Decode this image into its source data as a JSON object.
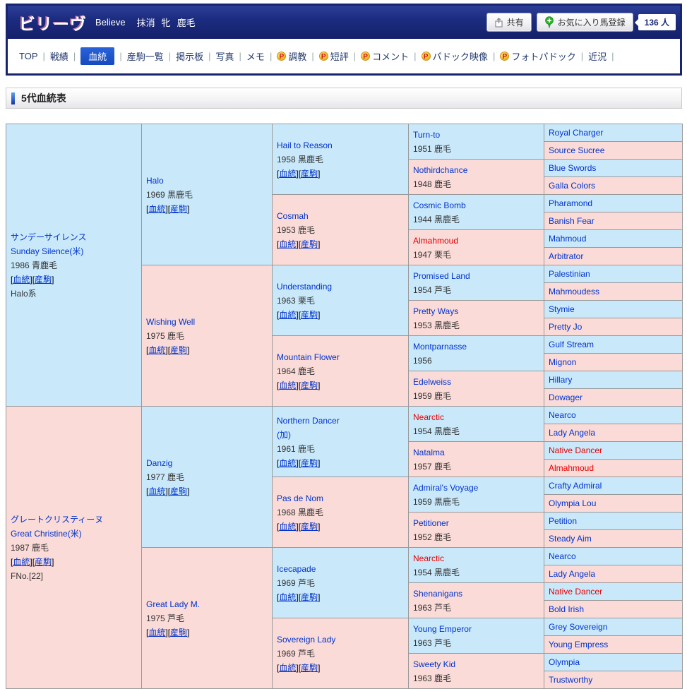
{
  "header": {
    "title": "ビリーヴ",
    "title_en": "Believe",
    "status": "抹消",
    "sex": "牝",
    "coat": "鹿毛",
    "share_label": "共有",
    "favorite_label": "お気に入り馬登録",
    "fans_label": "136 人"
  },
  "nav": {
    "separator": "|",
    "p_icon": "P",
    "items": [
      {
        "label": "TOP"
      },
      {
        "label": "戦績"
      },
      {
        "label": "血統",
        "active": true
      },
      {
        "label": "産駒一覧"
      },
      {
        "label": "掲示板"
      },
      {
        "label": "写真"
      },
      {
        "label": "メモ"
      },
      {
        "label": "調教",
        "p": true
      },
      {
        "label": "短評",
        "p": true
      },
      {
        "label": "コメント",
        "p": true
      },
      {
        "label": "パドック映像",
        "p": true
      },
      {
        "label": "フォトパドック",
        "p": true
      },
      {
        "label": "近況"
      }
    ]
  },
  "section": {
    "title": "5代血統表"
  },
  "colors": {
    "male_bg": "#c9e9fb",
    "female_bg": "#fbdbd8",
    "link_blue": "#0033cc",
    "inbreed_red": "#e60000",
    "nav_active_bg": "#1a52c8",
    "header_navy": "#1c2c80"
  },
  "pedigree": {
    "link_open": "[",
    "link_close": "]",
    "link_labels": [
      "血統",
      "産駒"
    ],
    "generations": [
      [
        {
          "name": "サンデーサイレンス",
          "name2": "Sunday Silence(米)",
          "detail": "1986 青鹿毛",
          "links": true,
          "extra": "Halo系",
          "sex": "m"
        },
        {
          "name": "グレートクリスティーヌ",
          "name2": "Great Christine(米)",
          "detail": "1987 鹿毛",
          "links": true,
          "extra": "FNo.[22]",
          "sex": "f"
        }
      ],
      [
        {
          "name": "Halo",
          "detail": "1969 黒鹿毛",
          "links": true,
          "sex": "m"
        },
        {
          "name": "Wishing Well",
          "detail": "1975 鹿毛",
          "links": true,
          "sex": "f"
        },
        {
          "name": "Danzig",
          "detail": "1977 鹿毛",
          "links": true,
          "sex": "m"
        },
        {
          "name": "Great Lady M.",
          "detail": "1975 芦毛",
          "links": true,
          "sex": "f"
        }
      ],
      [
        {
          "name": "Hail to Reason",
          "detail": "1958 黒鹿毛",
          "links": true,
          "sex": "m"
        },
        {
          "name": "Cosmah",
          "detail": "1953 鹿毛",
          "links": true,
          "sex": "f"
        },
        {
          "name": "Understanding",
          "detail": "1963 栗毛",
          "links": true,
          "sex": "m"
        },
        {
          "name": "Mountain Flower",
          "detail": "1964 鹿毛",
          "links": true,
          "sex": "f"
        },
        {
          "name": "Northern Dancer",
          "name2": "(加)",
          "detail": "1961 鹿毛",
          "links": true,
          "sex": "m"
        },
        {
          "name": "Pas de Nom",
          "detail": "1968 黒鹿毛",
          "links": true,
          "sex": "f"
        },
        {
          "name": "Icecapade",
          "detail": "1969 芦毛",
          "links": true,
          "sex": "m"
        },
        {
          "name": "Sovereign Lady",
          "detail": "1969 芦毛",
          "links": true,
          "sex": "f"
        }
      ],
      [
        {
          "name": "Turn-to",
          "detail": "1951 鹿毛",
          "sex": "m"
        },
        {
          "name": "Nothirdchance",
          "detail": "1948 鹿毛",
          "sex": "f"
        },
        {
          "name": "Cosmic Bomb",
          "detail": "1944 黒鹿毛",
          "sex": "m"
        },
        {
          "name": "Almahmoud",
          "detail": "1947 栗毛",
          "sex": "f",
          "red": true
        },
        {
          "name": "Promised Land",
          "detail": "1954 芦毛",
          "sex": "m"
        },
        {
          "name": "Pretty Ways",
          "detail": "1953 黒鹿毛",
          "sex": "f"
        },
        {
          "name": "Montparnasse",
          "detail": "1956",
          "sex": "m"
        },
        {
          "name": "Edelweiss",
          "detail": "1959 鹿毛",
          "sex": "f"
        },
        {
          "name": "Nearctic",
          "detail": "1954 黒鹿毛",
          "sex": "m",
          "red": true
        },
        {
          "name": "Natalma",
          "detail": "1957 鹿毛",
          "sex": "f"
        },
        {
          "name": "Admiral's Voyage",
          "detail": "1959 黒鹿毛",
          "sex": "m"
        },
        {
          "name": "Petitioner",
          "detail": "1952 鹿毛",
          "sex": "f"
        },
        {
          "name": "Nearctic",
          "detail": "1954 黒鹿毛",
          "sex": "m",
          "red": true
        },
        {
          "name": "Shenanigans",
          "detail": "1963 芦毛",
          "sex": "f"
        },
        {
          "name": "Young Emperor",
          "detail": "1963 芦毛",
          "sex": "m"
        },
        {
          "name": "Sweety Kid",
          "detail": "1963 鹿毛",
          "sex": "f"
        }
      ],
      [
        {
          "name": "Royal Charger",
          "sex": "m"
        },
        {
          "name": "Source Sucree",
          "sex": "f"
        },
        {
          "name": "Blue Swords",
          "sex": "m"
        },
        {
          "name": "Galla Colors",
          "sex": "f"
        },
        {
          "name": "Pharamond",
          "sex": "m"
        },
        {
          "name": "Banish Fear",
          "sex": "f"
        },
        {
          "name": "Mahmoud",
          "sex": "m"
        },
        {
          "name": "Arbitrator",
          "sex": "f"
        },
        {
          "name": "Palestinian",
          "sex": "m"
        },
        {
          "name": "Mahmoudess",
          "sex": "f"
        },
        {
          "name": "Stymie",
          "sex": "m"
        },
        {
          "name": "Pretty Jo",
          "sex": "f"
        },
        {
          "name": "Gulf Stream",
          "sex": "m"
        },
        {
          "name": "Mignon",
          "sex": "f"
        },
        {
          "name": "Hillary",
          "sex": "m"
        },
        {
          "name": "Dowager",
          "sex": "f"
        },
        {
          "name": "Nearco",
          "sex": "m"
        },
        {
          "name": "Lady Angela",
          "sex": "f"
        },
        {
          "name": "Native Dancer",
          "sex": "m",
          "red": true
        },
        {
          "name": "Almahmoud",
          "sex": "f",
          "red": true
        },
        {
          "name": "Crafty Admiral",
          "sex": "m"
        },
        {
          "name": "Olympia Lou",
          "sex": "f"
        },
        {
          "name": "Petition",
          "sex": "m"
        },
        {
          "name": "Steady Aim",
          "sex": "f"
        },
        {
          "name": "Nearco",
          "sex": "m"
        },
        {
          "name": "Lady Angela",
          "sex": "f"
        },
        {
          "name": "Native Dancer",
          "sex": "m",
          "red": true
        },
        {
          "name": "Bold Irish",
          "sex": "f"
        },
        {
          "name": "Grey Sovereign",
          "sex": "m"
        },
        {
          "name": "Young Empress",
          "sex": "f"
        },
        {
          "name": "Olympia",
          "sex": "m"
        },
        {
          "name": "Trustworthy",
          "sex": "f"
        }
      ]
    ]
  }
}
